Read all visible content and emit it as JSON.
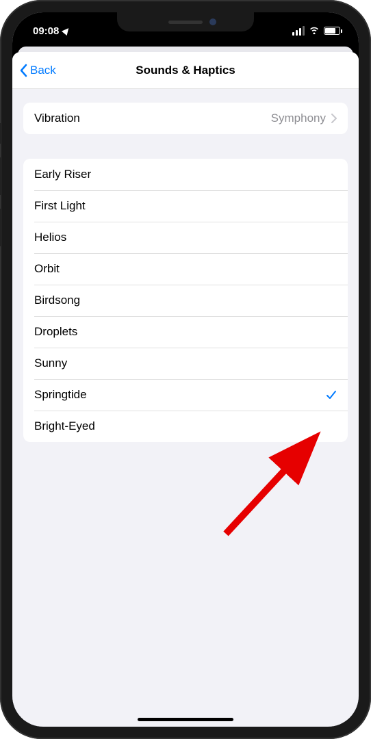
{
  "status_bar": {
    "time": "09:08"
  },
  "nav": {
    "back_label": "Back",
    "title": "Sounds & Haptics"
  },
  "vibration_section": {
    "label": "Vibration",
    "value": "Symphony"
  },
  "sounds": {
    "items": [
      {
        "label": "Early Riser",
        "selected": false
      },
      {
        "label": "First Light",
        "selected": false
      },
      {
        "label": "Helios",
        "selected": false
      },
      {
        "label": "Orbit",
        "selected": false
      },
      {
        "label": "Birdsong",
        "selected": false
      },
      {
        "label": "Droplets",
        "selected": false
      },
      {
        "label": "Sunny",
        "selected": false
      },
      {
        "label": "Springtide",
        "selected": true
      },
      {
        "label": "Bright-Eyed",
        "selected": false
      }
    ]
  }
}
